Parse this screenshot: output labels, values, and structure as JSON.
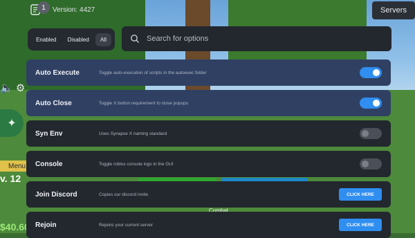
{
  "hud": {
    "badge_count": "1",
    "version": "Version: 4427",
    "menu_label": "Menu",
    "level_text": "v. 12",
    "money_text": "$40.60",
    "combat_label": "Combat",
    "servers_label": "Servers"
  },
  "filters": {
    "enabled_label": "Enabled",
    "disabled_label": "Disabled",
    "all_label": "All",
    "selected": "All"
  },
  "search": {
    "placeholder": "Search for options",
    "value": ""
  },
  "options": [
    {
      "title": "Auto Execute",
      "description": "Toggle auto-execution of scripts in the autoexec folder",
      "control": "toggle",
      "state": "on"
    },
    {
      "title": "Auto Close",
      "description": "Toggle X button requirement to close popups",
      "control": "toggle",
      "state": "on"
    },
    {
      "title": "Syn Env",
      "description": "Uses Synapse X naming standard",
      "control": "toggle",
      "state": "off"
    },
    {
      "title": "Console",
      "description": "Toggle roblox console logs in the GUI",
      "control": "toggle",
      "state": "off"
    },
    {
      "title": "Join Discord",
      "description": "Copies our discord invite",
      "control": "button",
      "button_label": "CLICK HERE"
    },
    {
      "title": "Rejoin",
      "description": "Rejoins your current server",
      "control": "button",
      "button_label": "CLICK HERE"
    }
  ],
  "colors": {
    "accent": "#2f8ef0",
    "row_enabled": "#2f4063",
    "row_default": "#23272e"
  }
}
